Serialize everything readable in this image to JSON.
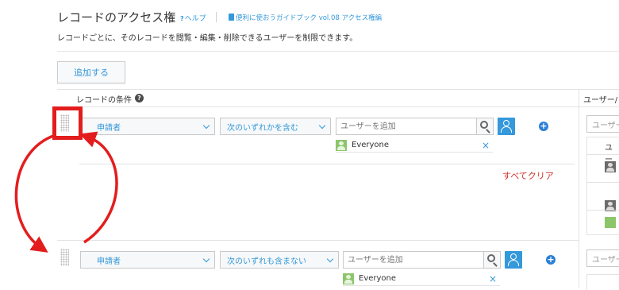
{
  "header": {
    "title": "レコードのアクセス権",
    "help_label": "ヘルプ",
    "help_prefix": "?",
    "guide_label": "便利に使おうガイドブック vol.08 アクセス権編",
    "description": "レコードごとに、そのレコードを閲覧・編集・削除できるユーザーを制限できます。"
  },
  "toolbar": {
    "add_label": "追加する"
  },
  "table": {
    "condition_header": "レコードの条件",
    "user_header": "ユーザー/"
  },
  "rows": [
    {
      "field": "申請者",
      "operator": "次のいずれかを含む",
      "user_placeholder": "ユーザーを追加",
      "entity": "Everyone",
      "clear_all": "すべてクリア"
    },
    {
      "field": "申請者",
      "operator": "次のいずれも含まない",
      "user_placeholder": "ユーザーを追加",
      "entity": "Everyone"
    }
  ],
  "right_column": {
    "input_placeholder": "ユーザー",
    "list_header": "ユー"
  },
  "icons": {
    "help": "question-icon",
    "guide": "book-icon",
    "search": "search-icon",
    "user_select": "user-icon",
    "add_condition": "plus-circle-icon",
    "entity": "group-icon",
    "remove": "close-icon",
    "drag": "drag-handle-icon"
  },
  "colors": {
    "link": "#3498db",
    "danger": "#d0342c",
    "annotation": "#e31d1d",
    "group": "#8cc56a"
  }
}
